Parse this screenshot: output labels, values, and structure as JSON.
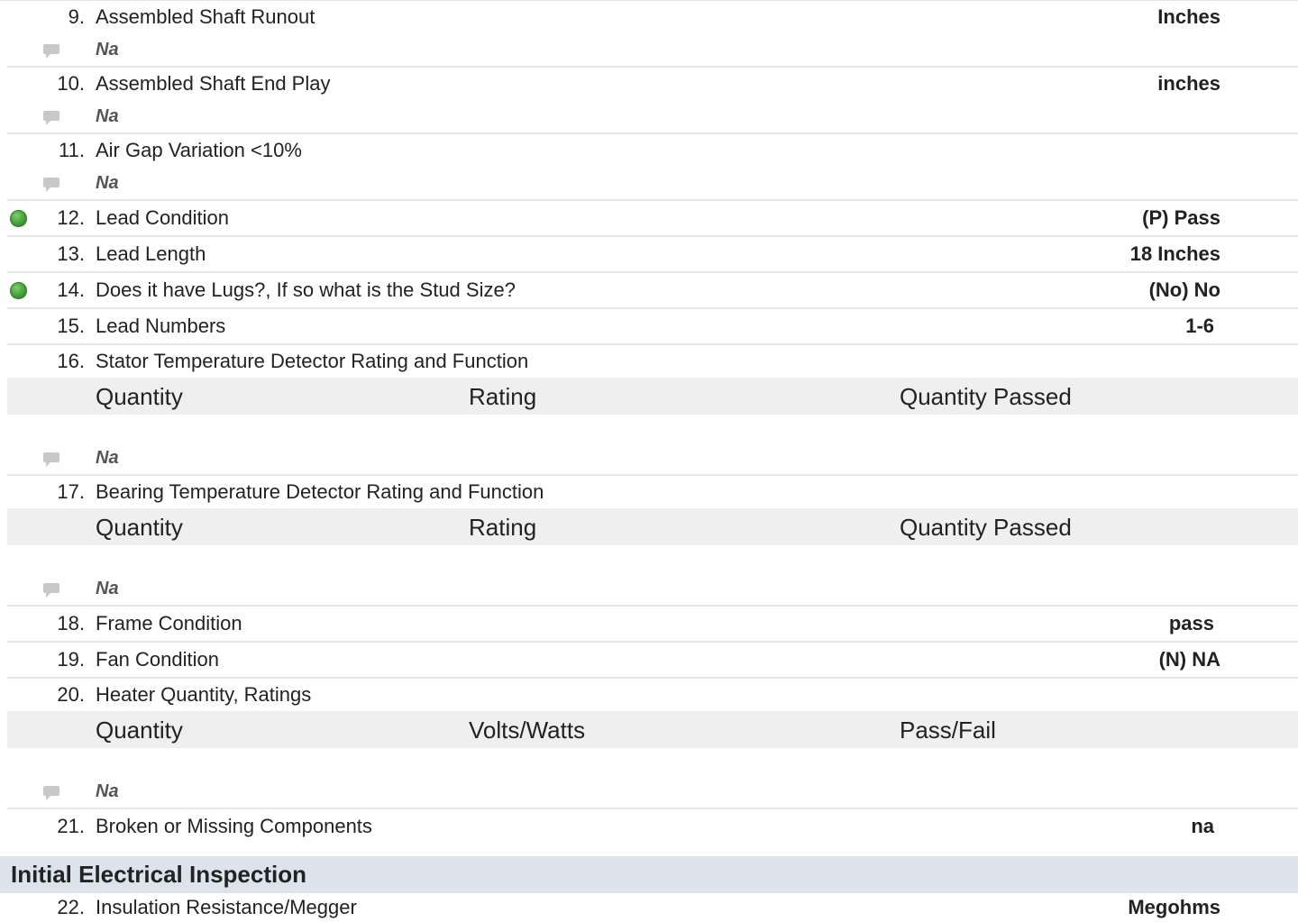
{
  "items": [
    {
      "num": "9.",
      "label": "Assembled Shaft Runout",
      "value": "Inches",
      "comment": "Na"
    },
    {
      "num": "10.",
      "label": "Assembled Shaft End Play",
      "value": "inches",
      "comment": "Na"
    },
    {
      "num": "11.",
      "label": "Air Gap Variation <10%",
      "value": "",
      "comment": "Na"
    },
    {
      "num": "12.",
      "label": "Lead Condition",
      "value": "(P) Pass"
    },
    {
      "num": "13.",
      "label": "Lead Length",
      "value": "18 Inches"
    },
    {
      "num": "14.",
      "label": "Does it have Lugs?, If so what is the Stud Size?",
      "value": "(No) No"
    },
    {
      "num": "15.",
      "label": "Lead Numbers",
      "value": "1-6"
    },
    {
      "num": "16.",
      "label": "Stator Temperature Detector Rating and Function",
      "cols": [
        "Quantity",
        "Rating",
        "Quantity Passed"
      ],
      "comment": "Na"
    },
    {
      "num": "17.",
      "label": "Bearing Temperature Detector Rating and Function",
      "cols": [
        "Quantity",
        "Rating",
        "Quantity Passed"
      ],
      "comment": "Na"
    },
    {
      "num": "18.",
      "label": "Frame Condition",
      "value": "pass"
    },
    {
      "num": "19.",
      "label": "Fan Condition",
      "value": "(N) NA"
    },
    {
      "num": "20.",
      "label": "Heater Quantity, Ratings",
      "cols": [
        "Quantity",
        "Volts/Watts",
        "Pass/Fail"
      ],
      "comment": "Na"
    },
    {
      "num": "21.",
      "label": "Broken or Missing Components",
      "value": "na"
    },
    {
      "num": "22.",
      "label": "Insulation Resistance/Megger",
      "value": "Megohms"
    }
  ],
  "section_title": "Initial Electrical Inspection",
  "status_color": "#3e9a34"
}
